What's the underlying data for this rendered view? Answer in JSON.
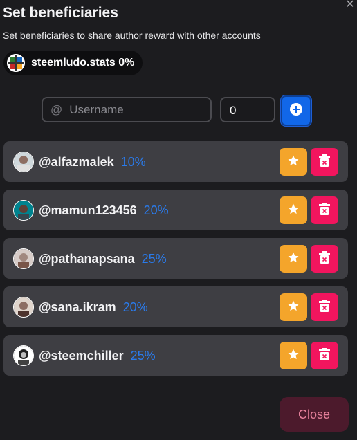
{
  "dialog": {
    "title": "Set beneficiaries",
    "subtitle": "Set beneficiaries to share author reward with other accounts",
    "close_label": "Close"
  },
  "author": {
    "name": "steemludo.stats",
    "weight": "0%"
  },
  "form": {
    "username_prefix": "@",
    "username_placeholder": "Username",
    "percent_value": "0"
  },
  "beneficiaries": [
    {
      "username": "@alfazmalek",
      "weight": "10%"
    },
    {
      "username": "@mamun123456",
      "weight": "20%"
    },
    {
      "username": "@pathanapsana",
      "weight": "25%"
    },
    {
      "username": "@sana.ikram",
      "weight": "20%"
    },
    {
      "username": "@steemchiller",
      "weight": "25%"
    }
  ],
  "icons": {
    "dismiss": "close-icon",
    "add": "plus-circle-icon",
    "star": "star-icon",
    "delete": "trash-icon"
  },
  "colors": {
    "accent_blue": "#1167e8",
    "weight_blue": "#2a7bec",
    "star_orange": "#f4a52b",
    "delete_pink": "#f2155e"
  }
}
